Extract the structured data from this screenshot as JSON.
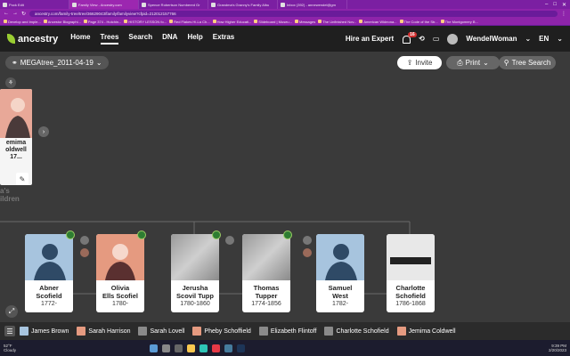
{
  "browser": {
    "tabs": [
      "Pock Edit",
      "Family View - Ancestry.com",
      "Spence Robertson Numbered Gr",
      "Grandma's Granny's Family Albu",
      "Inbox (392) - annewendel@gm"
    ],
    "url": "ancestry.com/family-tree/tree/36629043/family/familyview?cfpid=212012157766",
    "bookmarks": [
      "Develop and Imple...",
      "Ancestor Biographi...",
      "Page 374 - Hutchin...",
      "HISTORY LESSON fo...",
      "Red Flakes Hi-La Ch...",
      "How Higher Educati...",
      "Slideboard | Museu...",
      "Messages",
      "The Unfinished Nov...",
      "American Wideona...",
      "The Code of the Str...",
      "The Montgomery B..."
    ]
  },
  "header": {
    "brand": "ancestry",
    "nav": [
      "Home",
      "Trees",
      "Search",
      "DNA",
      "Help",
      "Extras"
    ],
    "active_nav": "Trees",
    "hire_expert": "Hire an Expert",
    "notification_count": "16",
    "username": "WendelWoman",
    "language": "EN"
  },
  "toolbar": {
    "tree_name": "MEGAtree_2011-04-19",
    "invite": "Invite",
    "print": "Print",
    "tree_search": "Tree Search"
  },
  "focus_person": {
    "name_lines": [
      "emima",
      "oldwell",
      "17..."
    ]
  },
  "children_label": [
    "a's",
    "ildren"
  ],
  "children": [
    {
      "first": "Abner",
      "last": "Scofield",
      "years": "1772-",
      "photo": "male"
    },
    {
      "first": "Olivia",
      "last": "Ells Scofiel",
      "years": "1780-",
      "photo": "female"
    },
    {
      "first": "Jerusha",
      "last": "Scovil Tupp",
      "years": "1780-1860",
      "photo": "photo"
    },
    {
      "first": "Thomas",
      "last": "Tupper",
      "years": "1774-1856",
      "photo": "photo"
    },
    {
      "first": "Samuel",
      "last": "West",
      "years": "1782-",
      "photo": "male"
    },
    {
      "first": "Charlotte",
      "last": "Schofield",
      "years": "1786-1868",
      "photo": "doc"
    }
  ],
  "family_strip": [
    "James Brown",
    "Sarah Harrison",
    "Sarah Lovell",
    "Pheby Schoffield",
    "Elizabeth Flintoff",
    "Charlotte Schofield",
    "Jemima Coldwell"
  ],
  "taskbar": {
    "weather_temp": "52°F",
    "weather_desc": "Cloudy",
    "time": "9:39 PM",
    "date": "2/20/2023"
  }
}
